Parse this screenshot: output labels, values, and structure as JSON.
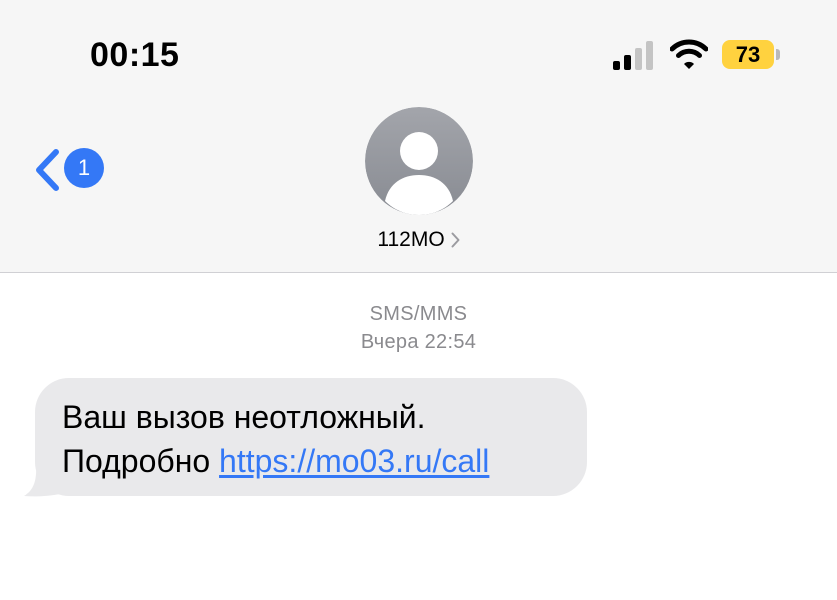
{
  "status_bar": {
    "time": "00:15",
    "battery_level": "73",
    "battery_color": "#ffd23f",
    "signal_icon": "cellular-signal-icon",
    "wifi_icon": "wifi-icon"
  },
  "nav": {
    "back_icon": "chevron-left-icon",
    "unread_count": "1",
    "accent_color": "#3478f6"
  },
  "contact": {
    "avatar_icon": "person-icon",
    "name": "112MO",
    "disclosure_icon": "chevron-right-icon"
  },
  "conversation": {
    "message_type": "SMS/MMS",
    "timestamp": "Вчера 22:54",
    "messages": [
      {
        "direction": "incoming",
        "line1": "Ваш вызов неотложный.",
        "line2_prefix": "Подробно ",
        "link": "https://mo03.ru/call"
      }
    ]
  }
}
